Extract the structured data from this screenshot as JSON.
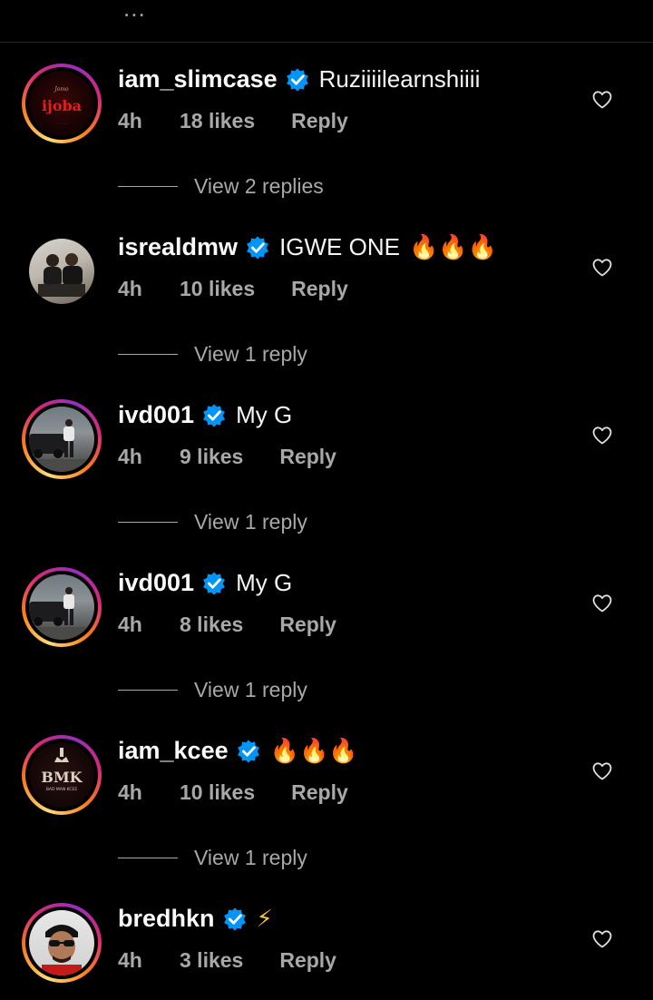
{
  "top": {
    "more_label": "..."
  },
  "comments": [
    {
      "username": "iam_slimcase",
      "verified": true,
      "text": "Ruziiiilearnshiiii",
      "time": "4h",
      "likes": "18 likes",
      "reply": "Reply",
      "view_replies": "View 2 replies",
      "story_ring": true,
      "avatar": "ijoba-logo",
      "avatar_text": "ijoba"
    },
    {
      "username": "isrealdmw",
      "verified": true,
      "text": "IGWE ONE",
      "emoji": "🔥🔥🔥",
      "time": "4h",
      "likes": "10 likes",
      "reply": "Reply",
      "view_replies": "View 1 reply",
      "story_ring": false,
      "avatar": "two-men-photo"
    },
    {
      "username": "ivd001",
      "verified": true,
      "text": "My G",
      "time": "4h",
      "likes": "9 likes",
      "reply": "Reply",
      "view_replies": "View 1 reply",
      "story_ring": true,
      "avatar": "man-car-photo"
    },
    {
      "username": "ivd001",
      "verified": true,
      "text": "My G",
      "time": "4h",
      "likes": "8 likes",
      "reply": "Reply",
      "view_replies": "View 1 reply",
      "story_ring": true,
      "avatar": "man-car-photo"
    },
    {
      "username": "iam_kcee",
      "verified": true,
      "text": "",
      "emoji": "🔥🔥🔥",
      "time": "4h",
      "likes": "10 likes",
      "reply": "Reply",
      "view_replies": "View 1 reply",
      "story_ring": true,
      "avatar": "bmk-logo",
      "avatar_text": "BMK",
      "avatar_subtext": "BAD MAN KCEE"
    },
    {
      "username": "bredhkn",
      "verified": true,
      "text": "",
      "emoji": "⚡",
      "time": "4h",
      "likes": "3 likes",
      "reply": "Reply",
      "story_ring": true,
      "avatar": "man-sunglasses-photo"
    }
  ],
  "colors": {
    "background": "#000000",
    "primary_text": "#fafafa",
    "secondary_text": "#a8a8a8",
    "verified_blue": "#0095f6"
  }
}
